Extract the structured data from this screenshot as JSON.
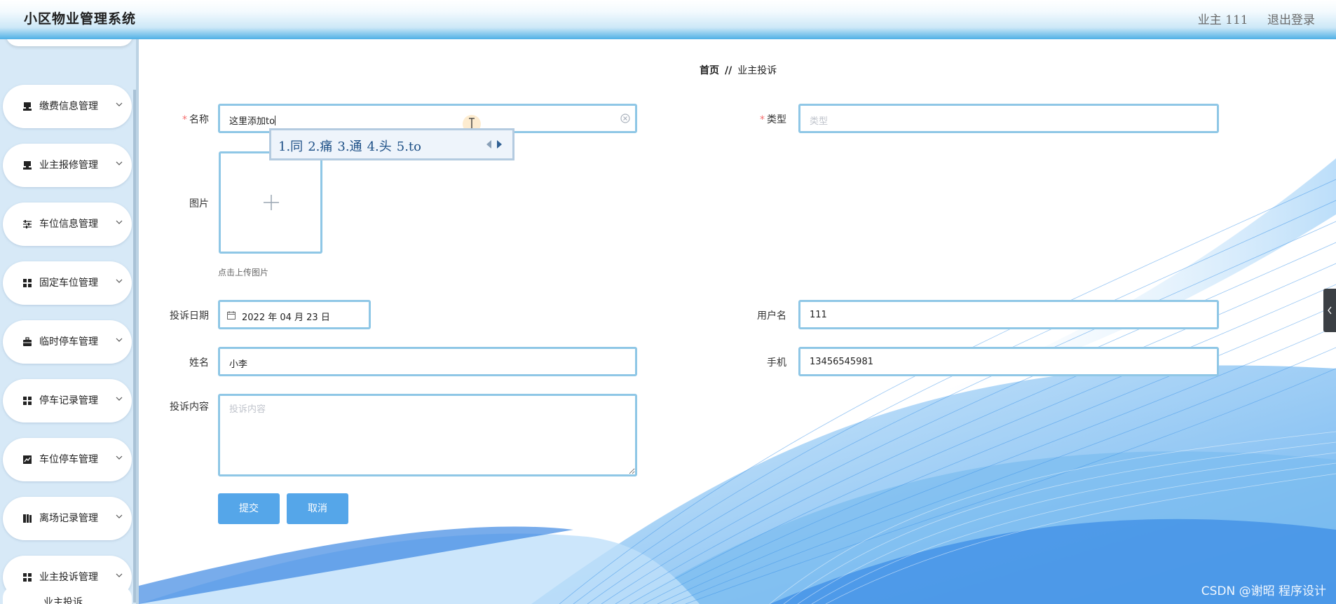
{
  "header": {
    "title": "小区物业管理系统",
    "user": "业主 111",
    "logout": "退出登录"
  },
  "sidebar": {
    "items": [
      {
        "label": "缴费信息管理",
        "icon": "cash-register-icon"
      },
      {
        "label": "业主报修管理",
        "icon": "cash-register-icon"
      },
      {
        "label": "车位信息管理",
        "icon": "sliders-icon"
      },
      {
        "label": "固定车位管理",
        "icon": "grid-icon"
      },
      {
        "label": "临时停车管理",
        "icon": "briefcase-icon"
      },
      {
        "label": "停车记录管理",
        "icon": "grid-icon"
      },
      {
        "label": "车位停车管理",
        "icon": "chart-icon"
      },
      {
        "label": "离场记录管理",
        "icon": "book-icon"
      },
      {
        "label": "业主投诉管理",
        "icon": "grid-icon"
      }
    ],
    "submenu_label": "业主投诉"
  },
  "breadcrumb": {
    "home": "首页",
    "separator": "//",
    "current": "业主投诉"
  },
  "form": {
    "name_label": "名称",
    "name_value": "这里添加to",
    "type_label": "类型",
    "type_placeholder": "类型",
    "image_label": "图片",
    "upload_hint": "点击上传图片",
    "date_label": "投诉日期",
    "date_value": "2022 年 04 月 23 日",
    "username_label": "用户名",
    "username_value": "111",
    "realname_label": "姓名",
    "realname_value": "小李",
    "phone_label": "手机",
    "phone_value": "13456545981",
    "content_label": "投诉内容",
    "content_placeholder": "投诉内容",
    "submit": "提交",
    "cancel": "取消"
  },
  "ime": {
    "candidates": [
      "1.同",
      "2.痛",
      "3.通",
      "4.头",
      "5.to"
    ]
  },
  "watermark": "CSDN @谢昭 程序设计",
  "colors": {
    "accent": "#55a6e9",
    "field_border": "#8fc7e6",
    "required": "#f56c6c",
    "sidebar_bg": "#d7e9f7",
    "header_gradient_end": "#4fb0e6"
  }
}
